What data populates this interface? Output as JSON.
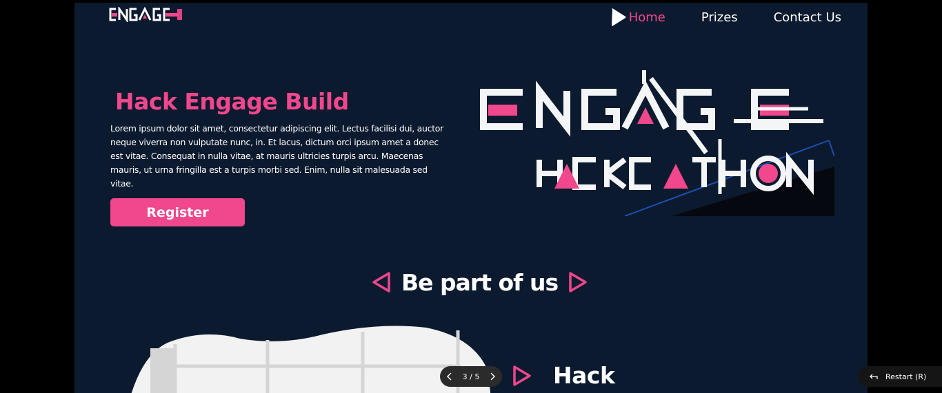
{
  "header": {
    "logo_text": "ENGAGE",
    "nav": [
      {
        "label": "Home",
        "active": true
      },
      {
        "label": "Prizes",
        "active": false
      },
      {
        "label": "Contact Us",
        "active": false
      }
    ]
  },
  "hero": {
    "title": "Hack Engage Build",
    "body": "Lorem ipsum dolor sit amet, consectetur adipiscing elit. Lectus facilisi dui, auctor neque viverra non vulputate nunc, in. Et lacus, dictum orci ipsum amet a donec est vitae. Consequat in nulla vitae, at mauris ultricies turpis arcu. Maecenas mauris, ut urna fringilla est a turpis morbi sed. Enim, nulla sit malesuada sed vitae.",
    "register_label": "Register",
    "graphic_line1": "ENGAGE",
    "graphic_line2": "HACKCATHON"
  },
  "section": {
    "title": "Be part of us",
    "subheading": "Hack"
  },
  "pager": {
    "text": "3 / 5"
  },
  "restart": {
    "label": "Restart (R)"
  },
  "colors": {
    "accent": "#f0478d",
    "background": "#0c1a2f",
    "text": "#ffffff"
  },
  "icons": [
    "play-icon",
    "triangle-left-icon",
    "triangle-right-icon",
    "chevron-left-icon",
    "chevron-right-icon",
    "restart-icon"
  ]
}
